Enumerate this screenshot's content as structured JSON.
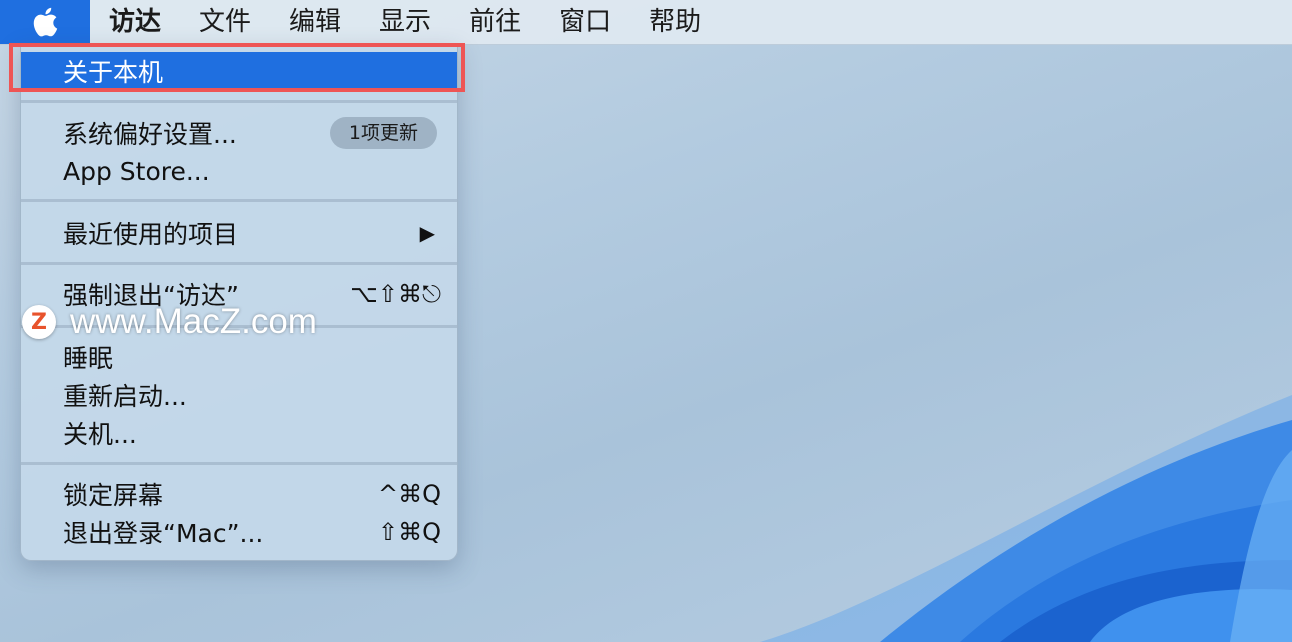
{
  "menubar": {
    "items": [
      "访达",
      "文件",
      "编辑",
      "显示",
      "前往",
      "窗口",
      "帮助"
    ]
  },
  "apple_menu": {
    "about": "关于本机",
    "system_prefs": {
      "label": "系统偏好设置...",
      "badge": "1项更新"
    },
    "app_store": "App Store...",
    "recent_items": {
      "label": "最近使用的项目",
      "arrow": "▶"
    },
    "force_quit": {
      "label": "强制退出“访达”",
      "shortcut": "⌥⇧⌘⎋"
    },
    "sleep": "睡眠",
    "restart": "重新启动...",
    "shutdown": "关机...",
    "lock_screen": {
      "label": "锁定屏幕",
      "shortcut": "^⌘Q"
    },
    "log_out": {
      "label": "退出登录“Mac”...",
      "shortcut": "⇧⌘Q"
    }
  },
  "watermark": {
    "logo": "Z",
    "text": "www.MacZ.com"
  },
  "colors": {
    "accent": "#1f6fe0",
    "highlight_box": "#ee5555"
  },
  "icons": [
    "apple-logo-icon",
    "chevron-right-icon"
  ]
}
